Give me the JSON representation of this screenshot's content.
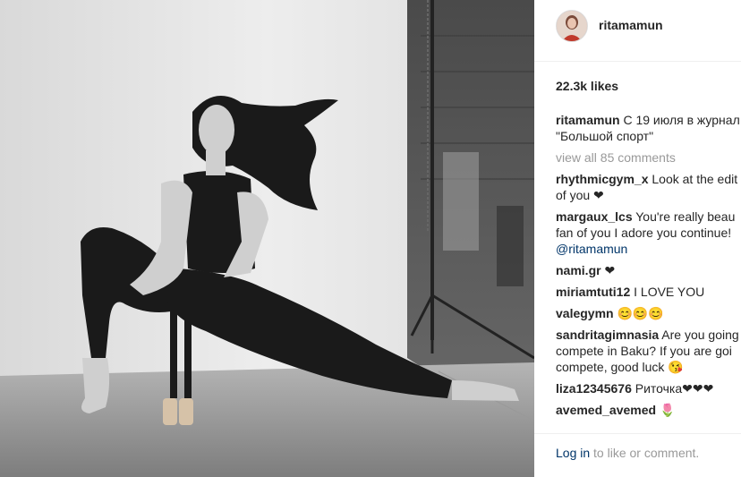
{
  "post": {
    "username": "ritamamun",
    "likes": "22.3k likes",
    "caption": {
      "username": "ritamamun",
      "line1": "С 19 июля в журнал",
      "line2": "\"Большой спорт\""
    },
    "view_all": "view all 85 comments",
    "comments": [
      {
        "user": "rhythmicgym_x",
        "lines": [
          "Look at the edit",
          "of you ❤"
        ]
      },
      {
        "user": "margaux_lcs",
        "lines": [
          "You're really beau",
          "fan of you I adore you continue!"
        ],
        "mention": "@ritamamun"
      },
      {
        "user": "nami.gr",
        "lines": [
          "❤"
        ]
      },
      {
        "user": "miriamtuti12",
        "lines": [
          "I LOVE YOU"
        ]
      },
      {
        "user": "valegymn",
        "lines": [
          "😊😊😊"
        ]
      },
      {
        "user": "sandritagimnasia",
        "lines": [
          "Are you going",
          "compete in Baku? If you are goi",
          "compete, good luck 😘"
        ]
      },
      {
        "user": "liza12345676",
        "lines": [
          "Риточка❤❤❤"
        ]
      },
      {
        "user": "avemed_avemed",
        "lines": [
          "🌷"
        ]
      }
    ]
  },
  "footer": {
    "login_link": "Log in",
    "login_rest": "to like or comment."
  },
  "colors": {
    "link": "#003569",
    "muted": "#999999",
    "border": "#efefef"
  },
  "icons": [
    "avatar-image"
  ]
}
